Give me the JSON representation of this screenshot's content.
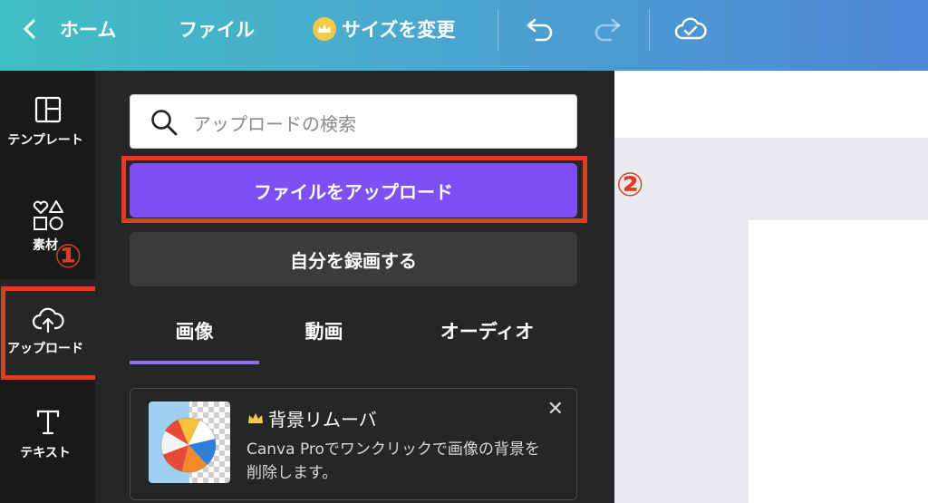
{
  "topbar": {
    "home_label": "ホーム",
    "file_label": "ファイル",
    "resize_label": "サイズを変更"
  },
  "rail": {
    "items": [
      {
        "label": "テンプレート"
      },
      {
        "label": "素材"
      },
      {
        "label": "アップロード"
      },
      {
        "label": "テキスト"
      }
    ]
  },
  "panel": {
    "search_placeholder": "アップロードの検索",
    "upload_button": "ファイルをアップロード",
    "record_button": "自分を録画する",
    "tabs": [
      {
        "label": "画像",
        "active": true
      },
      {
        "label": "動画"
      },
      {
        "label": "オーディオ"
      }
    ],
    "promo": {
      "title": "背景リムーバ",
      "description": "Canva Proでワンクリックで画像の背景を削除します。",
      "close": "✕"
    }
  },
  "annotations": {
    "marker_1": "①",
    "marker_2": "②"
  },
  "colors": {
    "accent_purple": "#7d4ff5",
    "highlight_red": "#e23b1e",
    "crown_gold": "#f7c948"
  }
}
